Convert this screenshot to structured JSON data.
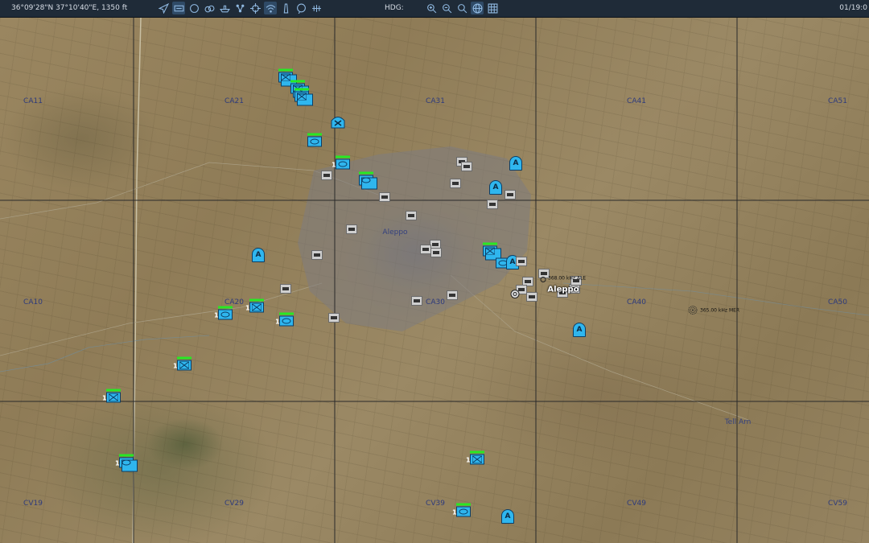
{
  "toolbar": {
    "coordinates": "36°09'28\"N 37°10'40\"E, 1350 ft",
    "hdg_label": "HDG:",
    "clock": "01/19:0",
    "tool_icons": [
      "navigate-icon",
      "layers-icon",
      "circle-icon",
      "weather-icon",
      "ship-icon",
      "network-icon",
      "target-icon",
      "wifi-icon",
      "tower-icon",
      "chat-icon",
      "radar-icon"
    ],
    "zoom_icons": [
      "zoom-in-icon",
      "zoom-out-icon",
      "zoom-reset-icon",
      "globe-icon",
      "grid-icon"
    ]
  },
  "map": {
    "grid_labels": [
      "CA11",
      "CA21",
      "CA31",
      "CA41",
      "CA51",
      "CA10",
      "CA20",
      "CA30",
      "CA40",
      "CA50",
      "CV19",
      "CV29",
      "CV39",
      "CV49",
      "CV59"
    ],
    "city_labels": [
      "Aleppo",
      "Tell Arn"
    ],
    "airfield_name": "Aleppo",
    "beacons": [
      "368.00 kHz ALE",
      "365.00 kHz MER"
    ],
    "unit_counts": [
      "1",
      "1",
      "1",
      "1",
      "1",
      "1",
      "1",
      "1",
      "1",
      "1"
    ],
    "air_defense_symbol": "A",
    "colors": {
      "friendly": "#2fb6ee",
      "health": "#27e823",
      "enemy": "#cfcfcf",
      "grid_line": "#2a2a2a",
      "grid_label": "#2d3a7c"
    }
  }
}
